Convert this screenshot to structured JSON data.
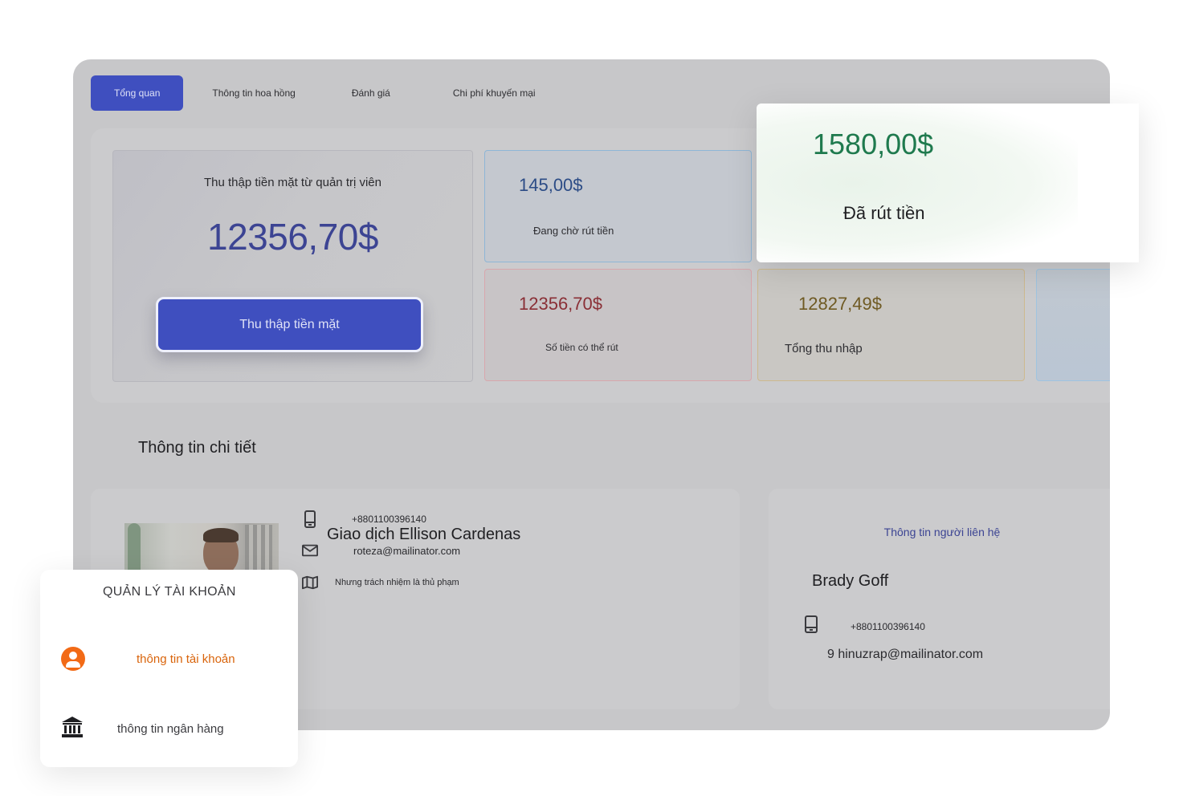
{
  "tabs": [
    {
      "label": "Tổng quan",
      "active": true
    },
    {
      "label": "Thông tin hoa hồng",
      "active": false
    },
    {
      "label": "Đánh giá",
      "active": false
    },
    {
      "label": "Chi phí khuyến mại",
      "active": false
    }
  ],
  "overview": {
    "main": {
      "label": "Thu thập tiền mặt từ quản trị viên",
      "amount": "12356,70$",
      "button": "Thu thập tiền mặt"
    },
    "pending": {
      "value": "145,00$",
      "label": "Đang chờ rút tiền"
    },
    "available": {
      "value": "12356,70$",
      "label": "Số tiền có thể rút"
    },
    "total": {
      "value": "12827,49$",
      "label": "Tổng thu nhập"
    }
  },
  "withdrawn": {
    "value": "1580,00$",
    "label": "Đã rút tiền"
  },
  "details": {
    "section_title": "Thông tin chi tiết",
    "transaction": {
      "name": "Giao dịch Ellison Cardenas",
      "phone": "+8801100396140",
      "email": "roteza@mailinator.com",
      "address": "Nhưng trách nhiệm là thủ phạm"
    },
    "contact": {
      "title": "Thông tin người liên hệ",
      "name": "Brady Goff",
      "phone": "+8801100396140",
      "email": "9 hinuzrap@mailinator.com"
    }
  },
  "account_menu": {
    "title": "QUẢN LÝ TÀI KHOẢN",
    "items": [
      {
        "label": "thông tin tài khoản",
        "icon": "account-circle-icon",
        "active": true
      },
      {
        "label": "thông tin ngân hàng",
        "icon": "bank-icon",
        "active": false
      }
    ]
  },
  "colors": {
    "primary": "#3f4fbf",
    "withdrawn_green": "#1f7a4e",
    "available_red": "#8a2f36",
    "total_gold": "#6f5a23",
    "pending_blue": "#2c4c86",
    "menu_active_orange": "#d9640b"
  }
}
